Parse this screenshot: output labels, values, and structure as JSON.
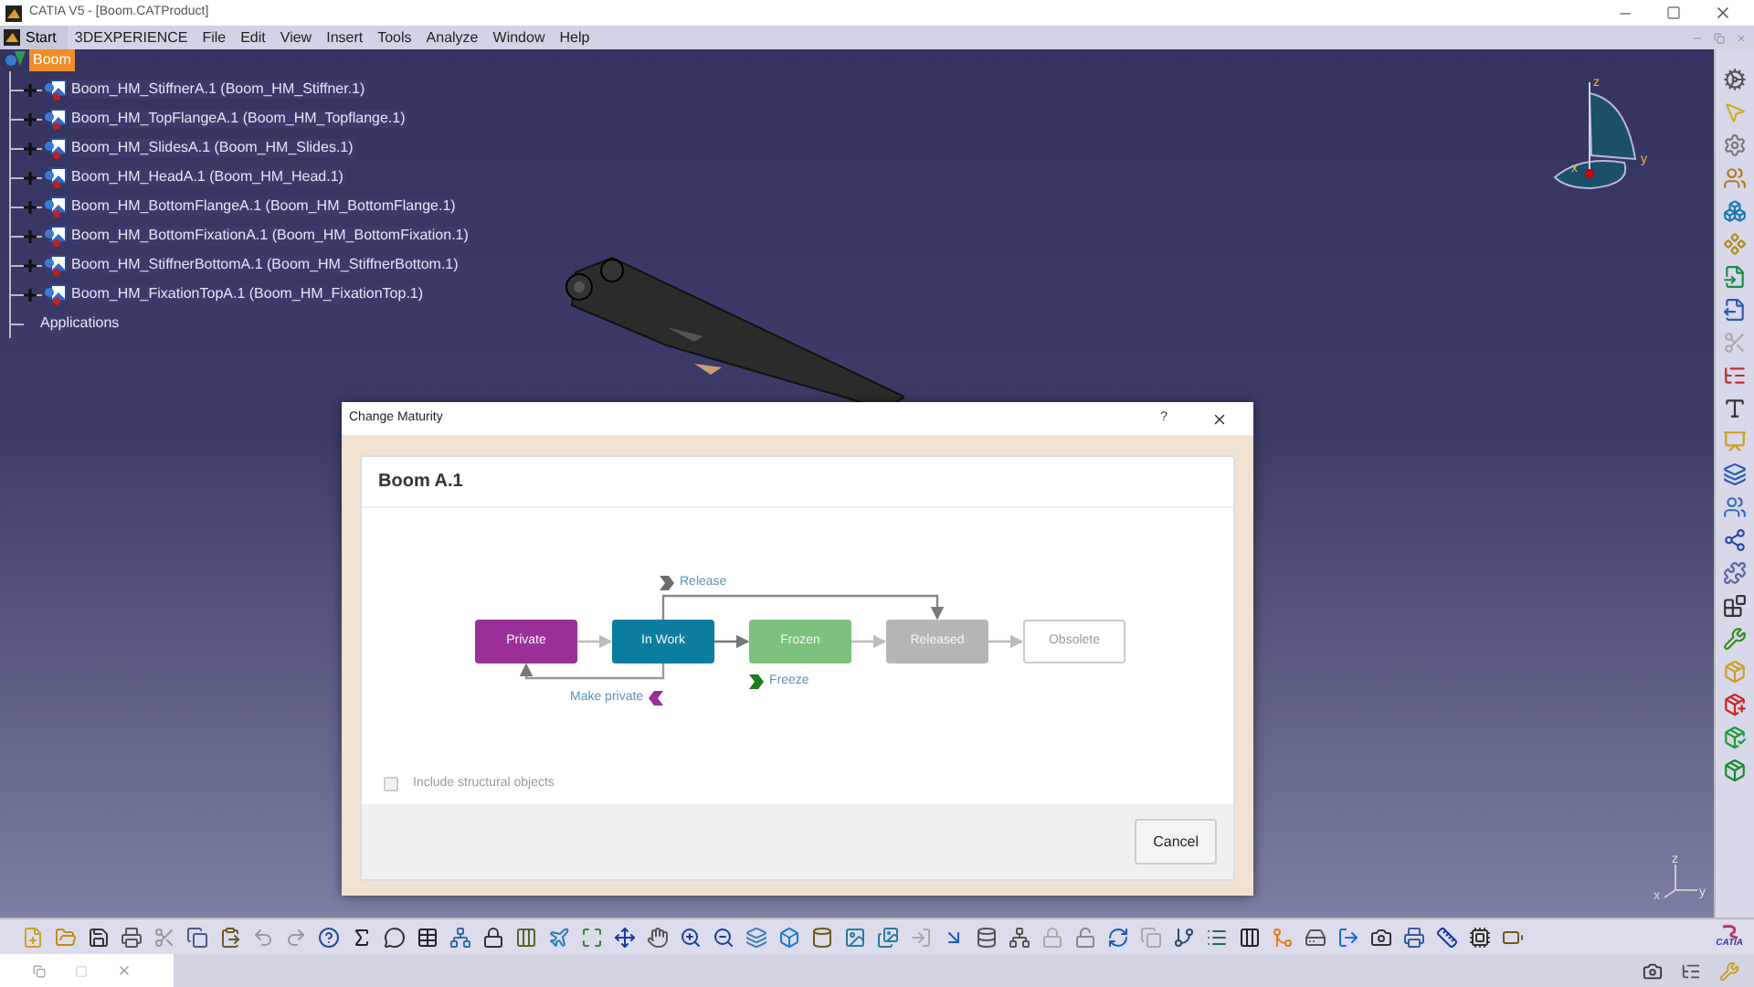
{
  "window": {
    "title": "CATIA V5 - [Boom.CATProduct]"
  },
  "menu": [
    {
      "label": "Start",
      "kind": "start"
    },
    {
      "label": "3DEXPERIENCE",
      "kind": "plain"
    },
    {
      "label": "File",
      "kind": "plain"
    },
    {
      "label": "Edit",
      "kind": "plain"
    },
    {
      "label": "View",
      "kind": "plain"
    },
    {
      "label": "Insert",
      "kind": "plain"
    },
    {
      "label": "Tools",
      "kind": "plain"
    },
    {
      "label": "Analyze",
      "kind": "plain"
    },
    {
      "label": "Window",
      "kind": "plain"
    },
    {
      "label": "Help",
      "kind": "plain"
    }
  ],
  "tree": {
    "label": "Boom",
    "selected": true,
    "children": [
      {
        "label": "Boom_HM_StiffnerA.1 (Boom_HM_Stiffner.1)",
        "selected": false,
        "kind": "part"
      },
      {
        "label": "Boom_HM_TopFlangeA.1 (Boom_HM_Topflange.1)",
        "selected": false,
        "kind": "part"
      },
      {
        "label": "Boom_HM_SlidesA.1 (Boom_HM_Slides.1)",
        "selected": false,
        "kind": "part"
      },
      {
        "label": "Boom_HM_HeadA.1 (Boom_HM_Head.1)",
        "selected": false,
        "kind": "part"
      },
      {
        "label": "Boom_HM_BottomFlangeA.1 (Boom_HM_BottomFlange.1)",
        "selected": false,
        "kind": "part"
      },
      {
        "label": "Boom_HM_BottomFixationA.1 (Boom_HM_BottomFixation.1)",
        "selected": false,
        "kind": "part"
      },
      {
        "label": "Boom_HM_StiffnerBottomA.1 (Boom_HM_StiffnerBottom.1)",
        "selected": false,
        "kind": "part"
      },
      {
        "label": "Boom_HM_FixationTopA.1 (Boom_HM_FixationTop.1)",
        "selected": false,
        "kind": "part"
      },
      {
        "label": "Applications",
        "selected": false,
        "kind": "applications"
      }
    ]
  },
  "compass": {
    "z": "z",
    "y": "y",
    "x": "x"
  },
  "mini_axis": {
    "z": "z",
    "x": "x",
    "y": "y"
  },
  "dialog": {
    "title": "Change Maturity",
    "help": "?",
    "object": "Boom A.1",
    "states": [
      {
        "label": "Private",
        "color": "#9a2f97",
        "kind": "filled"
      },
      {
        "label": "In Work",
        "color": "#0b7ea0",
        "kind": "filled"
      },
      {
        "label": "Frozen",
        "color": "#7dc17f",
        "kind": "filled"
      },
      {
        "label": "Released",
        "color": "#b5b5b5",
        "kind": "filled"
      },
      {
        "label": "Obsolete",
        "color": "#ffffff",
        "kind": "outline"
      }
    ],
    "transitions": [
      {
        "label": "Release",
        "color": "#6e6e6e"
      },
      {
        "label": "Freeze",
        "color": "#1a7d1f"
      },
      {
        "label": "Make private",
        "color": "#9a2f97"
      }
    ],
    "include_structural": {
      "label": "Include structural objects",
      "checked": false,
      "disabled": true
    },
    "buttons": [
      {
        "label": "Cancel"
      }
    ]
  },
  "logo": {
    "text": "CATIA"
  }
}
